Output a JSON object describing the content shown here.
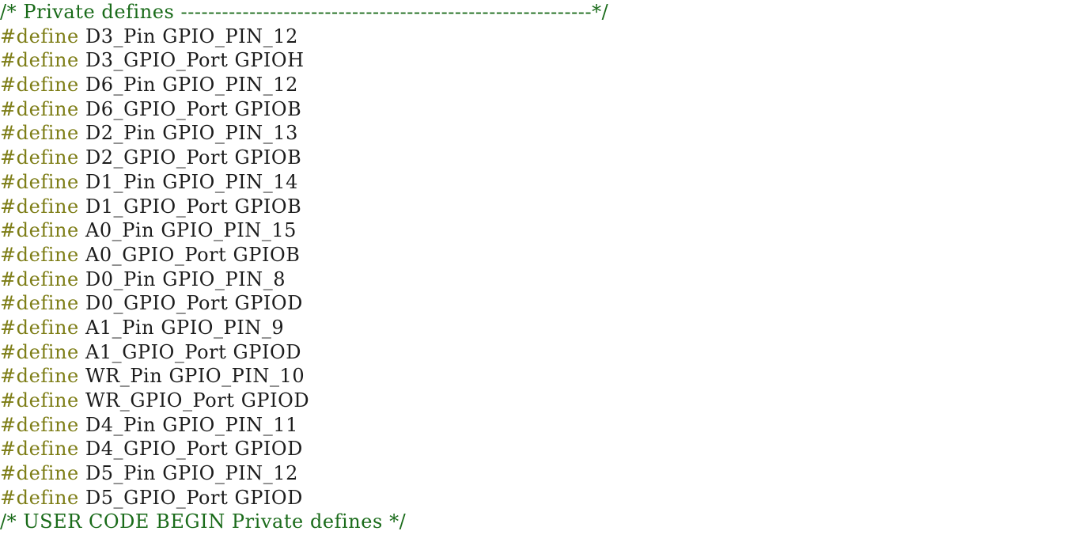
{
  "editor": {
    "background_color": "#ffffff",
    "comment_color": "#1a6b1a",
    "directive_color": "#7d7d16",
    "identifier_color": "#1c1c1c",
    "language": "C",
    "section": "Private defines"
  },
  "lines": [
    {
      "kind": "comment",
      "text": "/* Private defines ------------------------------------------------------------*/"
    },
    {
      "kind": "define",
      "directive": "#define",
      "name": "D3_Pin",
      "value": "GPIO_PIN_12"
    },
    {
      "kind": "define",
      "directive": "#define",
      "name": "D3_GPIO_Port",
      "value": "GPIOH"
    },
    {
      "kind": "define",
      "directive": "#define",
      "name": "D6_Pin",
      "value": "GPIO_PIN_12"
    },
    {
      "kind": "define",
      "directive": "#define",
      "name": "D6_GPIO_Port",
      "value": "GPIOB"
    },
    {
      "kind": "define",
      "directive": "#define",
      "name": "D2_Pin",
      "value": "GPIO_PIN_13"
    },
    {
      "kind": "define",
      "directive": "#define",
      "name": "D2_GPIO_Port",
      "value": "GPIOB"
    },
    {
      "kind": "define",
      "directive": "#define",
      "name": "D1_Pin",
      "value": "GPIO_PIN_14"
    },
    {
      "kind": "define",
      "directive": "#define",
      "name": "D1_GPIO_Port",
      "value": "GPIOB"
    },
    {
      "kind": "define",
      "directive": "#define",
      "name": "A0_Pin",
      "value": "GPIO_PIN_15"
    },
    {
      "kind": "define",
      "directive": "#define",
      "name": "A0_GPIO_Port",
      "value": "GPIOB"
    },
    {
      "kind": "define",
      "directive": "#define",
      "name": "D0_Pin",
      "value": "GPIO_PIN_8"
    },
    {
      "kind": "define",
      "directive": "#define",
      "name": "D0_GPIO_Port",
      "value": "GPIOD"
    },
    {
      "kind": "define",
      "directive": "#define",
      "name": "A1_Pin",
      "value": "GPIO_PIN_9"
    },
    {
      "kind": "define",
      "directive": "#define",
      "name": "A1_GPIO_Port",
      "value": "GPIOD"
    },
    {
      "kind": "define",
      "directive": "#define",
      "name": "WR_Pin",
      "value": "GPIO_PIN_10"
    },
    {
      "kind": "define",
      "directive": "#define",
      "name": "WR_GPIO_Port",
      "value": "GPIOD"
    },
    {
      "kind": "define",
      "directive": "#define",
      "name": "D4_Pin",
      "value": "GPIO_PIN_11"
    },
    {
      "kind": "define",
      "directive": "#define",
      "name": "D4_GPIO_Port",
      "value": "GPIOD"
    },
    {
      "kind": "define",
      "directive": "#define",
      "name": "D5_Pin",
      "value": "GPIO_PIN_12"
    },
    {
      "kind": "define",
      "directive": "#define",
      "name": "D5_GPIO_Port",
      "value": "GPIOD"
    },
    {
      "kind": "comment",
      "text": "/* USER CODE BEGIN Private defines */"
    }
  ]
}
